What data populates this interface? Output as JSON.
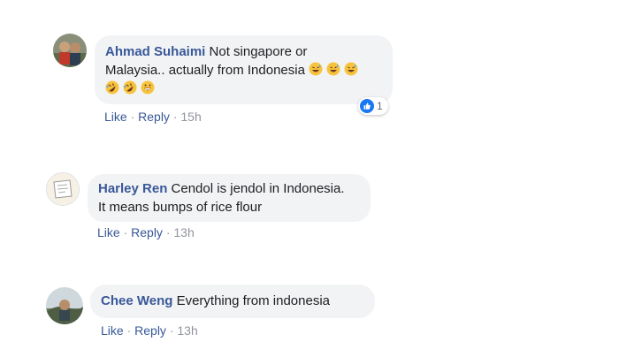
{
  "comments": [
    {
      "author": "Ahmad Suhaimi",
      "text_line1": " Not singapore or",
      "text_line2": "Malaysia.. actually from Indonesia",
      "like": "Like",
      "reply": "Reply",
      "time": "15h",
      "reaction_count": "1",
      "emoji_line1": [
        "grinning-sweat-icon",
        "grinning-sweat-icon",
        "grinning-sweat-icon"
      ],
      "emoji_line2": [
        "rolling-laughing-icon",
        "rolling-laughing-icon",
        "grinning-icon"
      ]
    },
    {
      "author": "Harley Ren",
      "text_line1": " Cendol is jendol in Indonesia.",
      "text_line2": "It means bumps of rice flour",
      "like": "Like",
      "reply": "Reply",
      "time": "13h"
    },
    {
      "author": "Chee Weng",
      "text_line1": " Everything from indonesia",
      "like": "Like",
      "reply": "Reply",
      "time": "13h"
    }
  ],
  "separator": " · ",
  "colors": {
    "link": "#385898",
    "bubble": "#f2f3f5",
    "meta": "#90949c",
    "like_blue": "#1877f2"
  }
}
